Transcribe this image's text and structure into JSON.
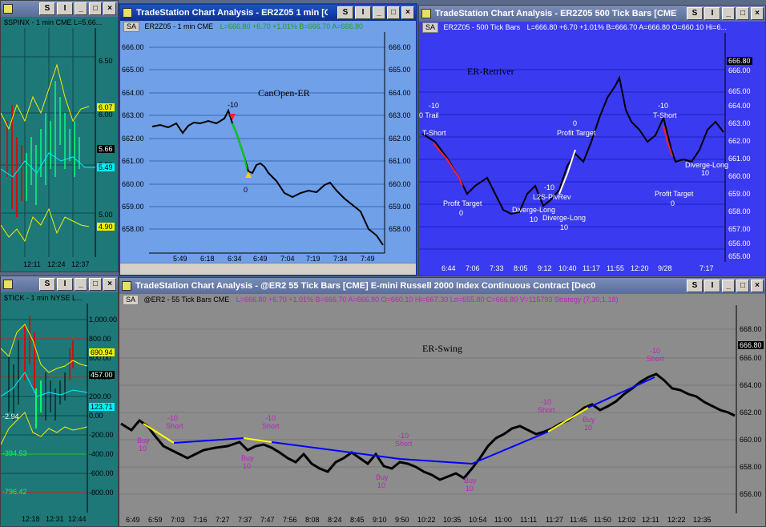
{
  "windows": {
    "w1": {
      "title": "",
      "header": "$SPINX - 1 min  CME  L=5.66...",
      "y_ticks": [
        "6.50",
        "6.00",
        "5.50",
        "5.00"
      ],
      "badges": [
        {
          "text": "6.07",
          "color": "#f0f000"
        },
        {
          "text": "5.66",
          "color": "#000000"
        },
        {
          "text": "5.49",
          "color": "#00f0ff"
        },
        {
          "text": "4.90",
          "color": "#f0f000"
        }
      ],
      "x_ticks": [
        "12:11",
        "12:24",
        "12:37"
      ]
    },
    "w2": {
      "title": "TradeStation Chart Analysis - ER2Z05  1 min  [CM...",
      "header": {
        "sa": "SA",
        "symbol": "ER2Z05 - 1 min   CME",
        "quote": "L=666.80  +6.70  +1.01%  B=666.70  A=666.80"
      },
      "label": "CanOpen-ER",
      "y_ticks": [
        "666.00",
        "665.00",
        "664.00",
        "663.00",
        "662.00",
        "661.00",
        "660.00",
        "659.00",
        "658.00"
      ],
      "x_ticks": [
        "5:49",
        "6:18",
        "6:34",
        "6:49",
        "7:04",
        "7:19",
        "7:34",
        "7:49"
      ],
      "annotations": [
        "-10",
        "0"
      ]
    },
    "w3": {
      "title": "TradeStation Chart Analysis - ER2Z05  500 Tick Bars [CME] E-...",
      "header": {
        "sa": "SA",
        "symbol": "ER2Z05 - 500 Tick Bars",
        "quote": "L=666.80  +6.70  +1.01%  B=666.70  A=666.80  O=660.10  Hi=6..."
      },
      "label": "ER-Retriver",
      "y_ticks": [
        "666.00",
        "665.00",
        "664.00",
        "663.00",
        "662.00",
        "661.00",
        "660.00",
        "659.00",
        "658.00",
        "657.00",
        "656.00",
        "655.00"
      ],
      "last_price": "666.80",
      "x_ticks": [
        "6:44",
        "7:06",
        "7:33",
        "8:05",
        "9:12",
        "10:40",
        "11:17",
        "11:55",
        "12:20",
        "9/28",
        "7:17"
      ],
      "annotations": [
        "-10",
        "0 Trail",
        "T-Short",
        "Profit Target",
        "0",
        "Diverge-Long",
        "10",
        "L2S-PivRev",
        "-10",
        "Diverge-Long",
        "10",
        "0",
        "Profit Target",
        "-10",
        "T-Short",
        "Diverge-Long",
        "10",
        "Profit Target",
        "0"
      ]
    },
    "w4": {
      "title": "",
      "header": "$TICK - 1 min   NYSE  L...",
      "y_ticks": [
        "1,000.00",
        "800.00",
        "600.00",
        "400.00",
        "200.00",
        "0.00",
        "-200.00",
        "-400.00",
        "-600.00",
        "-800.00"
      ],
      "badges": [
        {
          "text": "690.94",
          "color": "#f0f000"
        },
        {
          "text": "457.00",
          "color": "#000000"
        },
        {
          "text": "123.71",
          "color": "#00f0ff"
        }
      ],
      "side_labels": [
        "-2.94",
        "-394.53",
        "-796.42"
      ],
      "x_ticks": [
        "12:18",
        "12:31",
        "12:44"
      ]
    },
    "w5": {
      "title": "TradeStation Chart Analysis - @ER2  55 Tick Bars [CME] E-mini Russell 2000 Index Continuous Contract [Dec0",
      "header": {
        "sa": "SA",
        "symbol": "@ER2 - 55 Tick Bars   CME",
        "quote": "L=666.80  +6.70  +1.01%  B=666.70  A=666.80  O=660.10  Hi=667.30  Lo=655.80  C=666.80  V=115793  Strategy (7,30,1.18)"
      },
      "label": "ER-Swing",
      "y_ticks": [
        "668.00",
        "666.00",
        "664.00",
        "662.00",
        "660.00",
        "658.00",
        "656.00"
      ],
      "last_price": "666.80",
      "x_ticks": [
        "6:49",
        "6:59",
        "7:03",
        "7:16",
        "7:27",
        "7:37",
        "7:47",
        "7:56",
        "8:08",
        "8:24",
        "8:45",
        "9:10",
        "9:50",
        "10:22",
        "10:35",
        "10:54",
        "11:00",
        "11:11",
        "11:27",
        "11:45",
        "11:50",
        "12:02",
        "12:11",
        "12:22",
        "12:35"
      ],
      "annotations": [
        "Buy",
        "10",
        "-10",
        "Short",
        "Buy",
        "10",
        "-10",
        "Short",
        "-10",
        "Short",
        "Buy",
        "10",
        "Buy",
        "10",
        "-10",
        "Short",
        "Buy",
        "10",
        "-10",
        "Short"
      ]
    }
  }
}
